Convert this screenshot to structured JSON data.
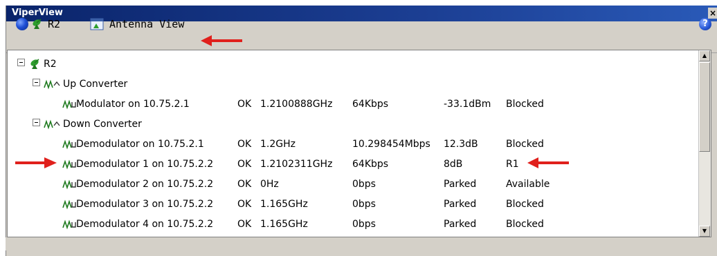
{
  "window": {
    "title": "ViperView",
    "close_glyph": "×"
  },
  "toolbar": {
    "globe_icon": "globe-icon",
    "radio_label": "R2",
    "antenna_label": "Antenna View",
    "help_glyph": "?"
  },
  "tree": {
    "root": {
      "label": "R2",
      "icon": "satellite-dish-icon"
    },
    "groups": [
      {
        "label": "Up Converter",
        "icon": "waveform-icon",
        "items": [
          {
            "label": "Modulator on 10.75.2.1",
            "status": "OK",
            "frequency": "1.2100888GHz",
            "rate": "64Kbps",
            "level": "-33.1dBm",
            "state": "Blocked"
          }
        ]
      },
      {
        "label": "Down Converter",
        "icon": "waveform-icon",
        "items": [
          {
            "label": "Demodulator on 10.75.2.1",
            "status": "OK",
            "frequency": "1.2GHz",
            "rate": "10.298454Mbps",
            "level": "12.3dB",
            "state": "Blocked"
          },
          {
            "label": "Demodulator 1 on 10.75.2.2",
            "status": "OK",
            "frequency": "1.2102311GHz",
            "rate": "64Kbps",
            "level": "8dB",
            "state": "R1"
          },
          {
            "label": "Demodulator 2 on 10.75.2.2",
            "status": "OK",
            "frequency": "0Hz",
            "rate": "0bps",
            "level": "Parked",
            "state": "Available"
          },
          {
            "label": "Demodulator 3 on 10.75.2.2",
            "status": "OK",
            "frequency": "1.165GHz",
            "rate": "0bps",
            "level": "Parked",
            "state": "Blocked"
          },
          {
            "label": "Demodulator 4 on 10.75.2.2",
            "status": "OK",
            "frequency": "1.165GHz",
            "rate": "0bps",
            "level": "Parked",
            "state": "Blocked"
          }
        ]
      }
    ]
  },
  "colors": {
    "title_bar": "#0a246a",
    "annotation_arrow": "#e0201c",
    "chrome": "#d4d0c8"
  }
}
